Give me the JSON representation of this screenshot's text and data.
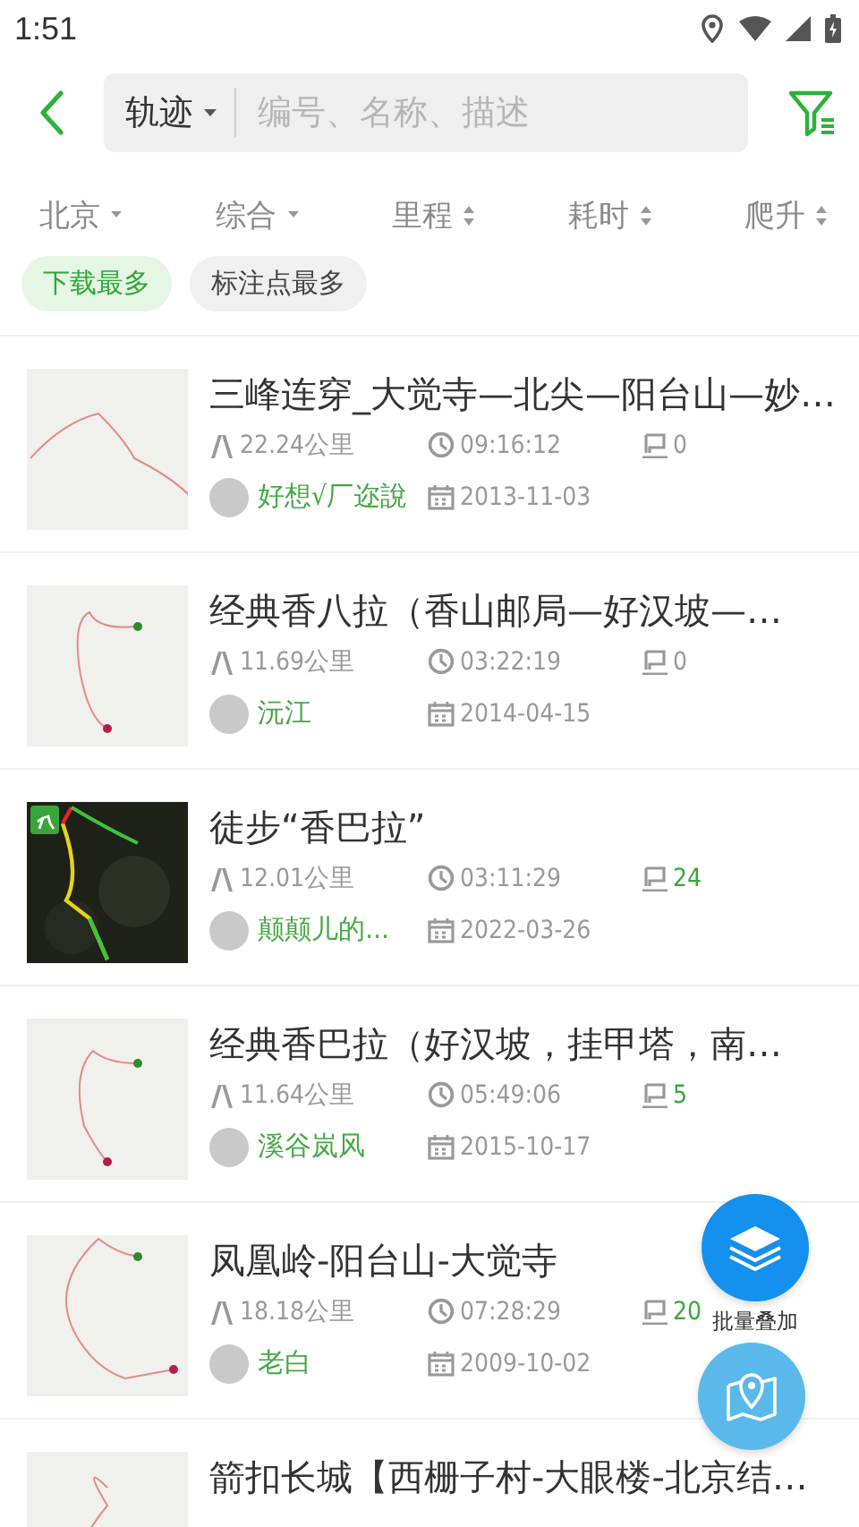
{
  "status_bar": {
    "time": "1:51"
  },
  "header": {
    "search_scope": "轨迹",
    "placeholder": "编号、名称、描述"
  },
  "filters": [
    {
      "label": "北京",
      "kind": "dropdown"
    },
    {
      "label": "综合",
      "kind": "dropdown"
    },
    {
      "label": "里程",
      "kind": "sort"
    },
    {
      "label": "耗时",
      "kind": "sort"
    },
    {
      "label": "爬升",
      "kind": "sort"
    }
  ],
  "chips": [
    {
      "label": "下载最多",
      "selected": true
    },
    {
      "label": "标注点最多",
      "selected": false
    }
  ],
  "tracks": [
    {
      "title": "三峰连穿_大觉寺—北尖—阳台山—妙…",
      "kind": "map",
      "distance": "22.24公里",
      "duration": "09:16:12",
      "points": "0",
      "points_highlight": false,
      "author": "好想√厂迩說",
      "date": "2013-11-03"
    },
    {
      "title": "经典香八拉（香山邮局—好汉坡—…",
      "kind": "map",
      "distance": "11.69公里",
      "duration": "03:22:19",
      "points": "0",
      "points_highlight": false,
      "author": "沅江",
      "date": "2014-04-15"
    },
    {
      "title": "徒步“香巴拉”",
      "kind": "satellite",
      "distance": "12.01公里",
      "duration": "03:11:29",
      "points": "24",
      "points_highlight": true,
      "author": "颠颠儿的…",
      "date": "2022-03-26"
    },
    {
      "title": "经典香巴拉（好汉坡，挂甲塔，南…",
      "kind": "map",
      "distance": "11.64公里",
      "duration": "05:49:06",
      "points": "5",
      "points_highlight": true,
      "author": "溪谷岚风",
      "date": "2015-10-17"
    },
    {
      "title": "凤凰岭-阳台山-大觉寺",
      "kind": "map",
      "distance": "18.18公里",
      "duration": "07:28:29",
      "points": "20",
      "points_highlight": true,
      "author": "老白",
      "date": "2009-10-02"
    },
    {
      "title": "箭扣长城【西栅子村-大眼楼-北京结…",
      "kind": "map"
    }
  ],
  "fabs": [
    {
      "kind": "layers",
      "label": "批量叠加"
    },
    {
      "kind": "map"
    }
  ]
}
